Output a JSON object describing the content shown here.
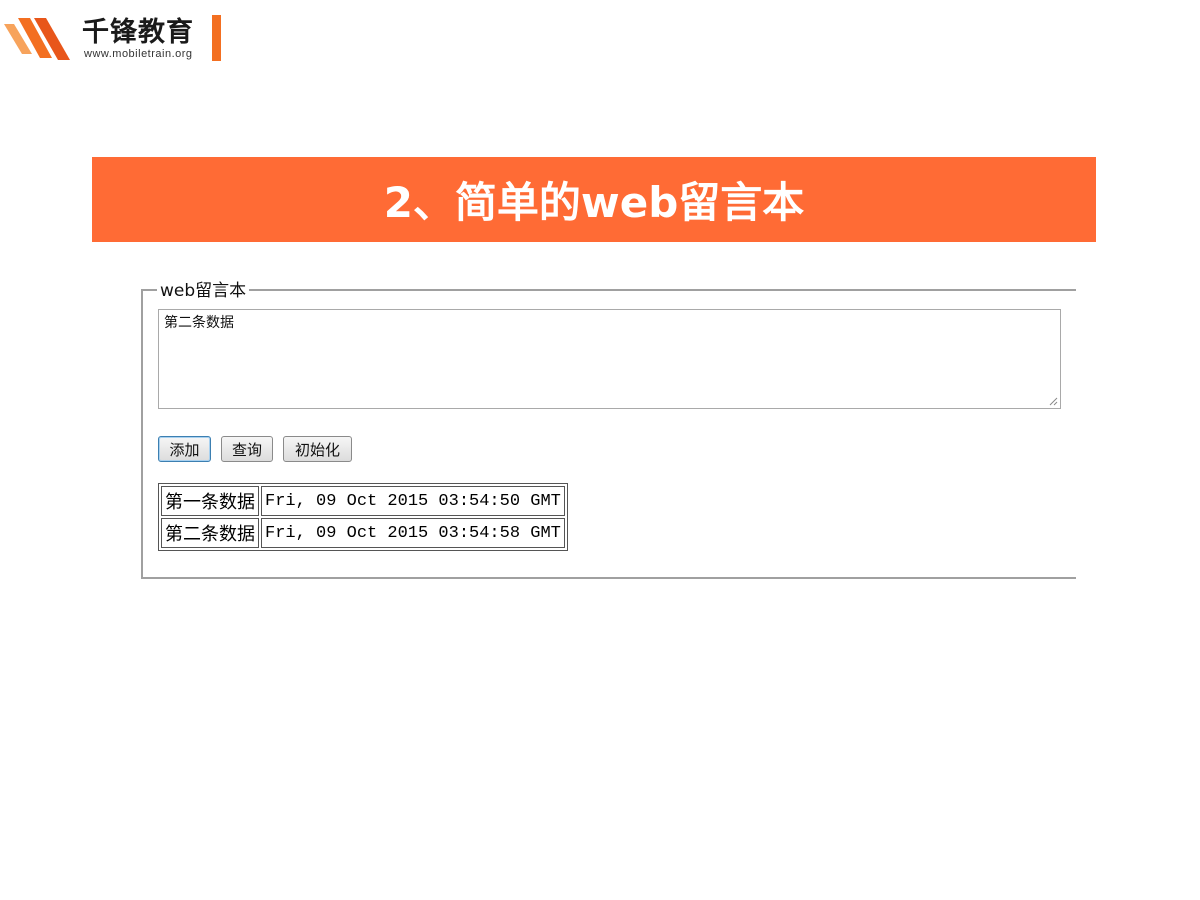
{
  "logo": {
    "name": "千锋教育",
    "url": "www.mobiletrain.org",
    "accent_color": "#f36f21"
  },
  "banner": {
    "title": "2、简单的web留言本",
    "background_color": "#ff6b35"
  },
  "guestbook": {
    "legend": "web留言本",
    "textarea_value": "第二条数据",
    "buttons": {
      "add": "添加",
      "query": "查询",
      "init": "初始化"
    },
    "messages": [
      {
        "text": "第一条数据",
        "time": "Fri, 09 Oct 2015 03:54:50 GMT"
      },
      {
        "text": "第二条数据",
        "time": "Fri, 09 Oct 2015 03:54:58 GMT"
      }
    ]
  }
}
